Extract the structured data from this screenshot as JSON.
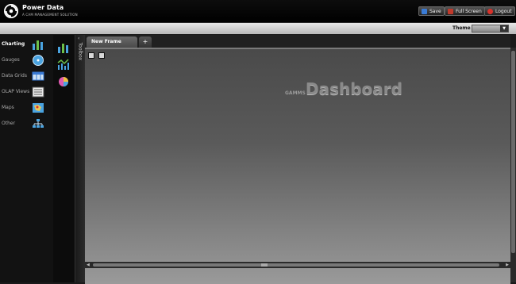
{
  "brand": {
    "title": "Power Data",
    "subtitle": "A CAM MANAGEMENT SOLUTION"
  },
  "topbar": {
    "save_label": "Save",
    "fullscreen_label": "Full Screen",
    "logout_label": "Logout"
  },
  "theme": {
    "label": "Theme",
    "selected": ""
  },
  "categories": [
    {
      "label": "Charting",
      "icon": "bar-chart-icon"
    },
    {
      "label": "Gauges",
      "icon": "gauge-icon"
    },
    {
      "label": "Data Grids",
      "icon": "grid-icon"
    },
    {
      "label": "OLAP Views",
      "icon": "olap-icon"
    },
    {
      "label": "Maps",
      "icon": "map-icon"
    },
    {
      "label": "Other",
      "icon": "org-chart-icon"
    }
  ],
  "widgets": [
    {
      "icon": "bar-chart-icon"
    },
    {
      "icon": "line-chart-icon"
    },
    {
      "icon": "pie-chart-icon"
    }
  ],
  "toolbox": {
    "label": "Toolbox"
  },
  "tabs": {
    "active_label": "New Frame",
    "add_label": "+"
  },
  "dashboard": {
    "small_label": "GAMMS",
    "title": "Dashboard"
  },
  "colors": {
    "save": "#3a7bd5",
    "fullscreen": "#c0392b",
    "logout": "#d9322b"
  }
}
